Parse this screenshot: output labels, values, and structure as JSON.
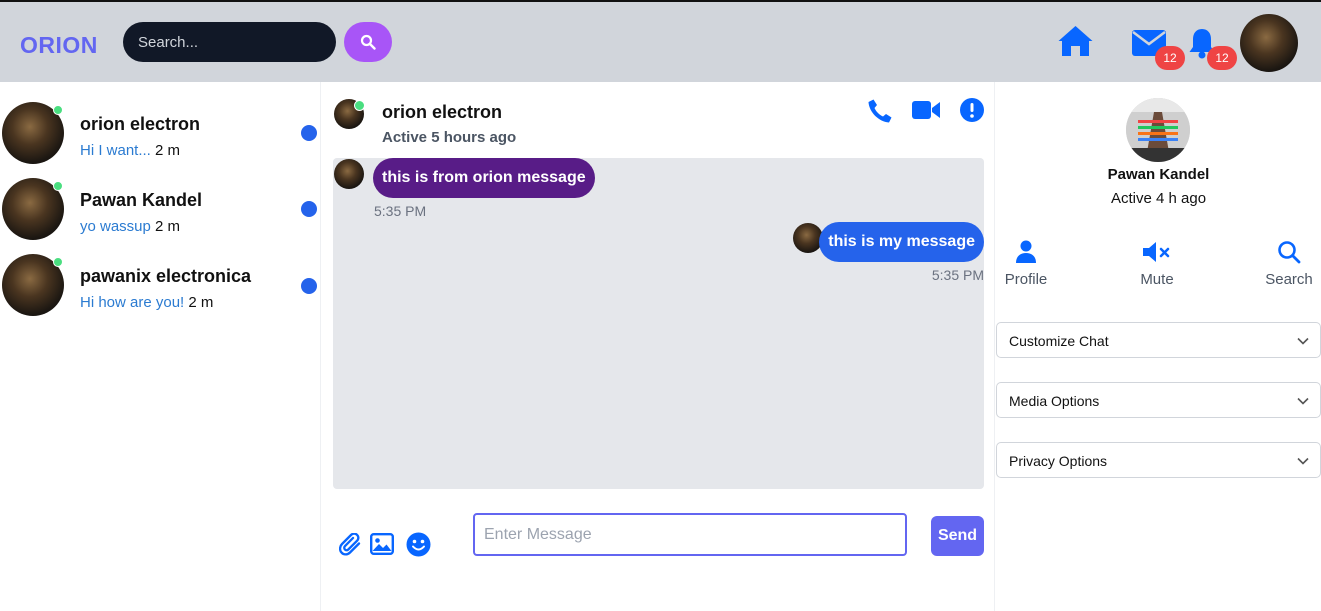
{
  "header": {
    "logo": "ORION",
    "search_placeholder": "Search...",
    "messages_badge": "12",
    "notifications_badge": "12"
  },
  "conversations": [
    {
      "name": "orion electron",
      "preview": "Hi I want...",
      "time": "2 m",
      "online": true,
      "unread": true
    },
    {
      "name": "Pawan Kandel",
      "preview": "yo wassup",
      "time": "2 m",
      "online": true,
      "unread": true
    },
    {
      "name": "pawanix electronica",
      "preview": "Hi how are you!",
      "time": "2 m",
      "online": true,
      "unread": true
    }
  ],
  "chat": {
    "name": "orion electron",
    "status": "Active 5 hours ago",
    "messages": [
      {
        "text": "this is from orion message",
        "time": "5:35 PM",
        "direction": "incoming",
        "color": "#581c87"
      },
      {
        "text": "this is my message",
        "time": "5:35 PM",
        "direction": "outgoing",
        "color": "#2563eb"
      }
    ],
    "input_placeholder": "Enter Message",
    "send_label": "Send"
  },
  "profile": {
    "name": "Pawan Kandel",
    "status": "Active 4 h ago",
    "actions": [
      "Profile",
      "Mute",
      "Search"
    ],
    "sections": [
      "Customize Chat",
      "Media Options",
      "Privacy Options"
    ]
  },
  "colors": {
    "accent": "#6366f1",
    "icon_blue": "#0866ff",
    "badge": "#ef4444",
    "online": "#4ade80"
  }
}
